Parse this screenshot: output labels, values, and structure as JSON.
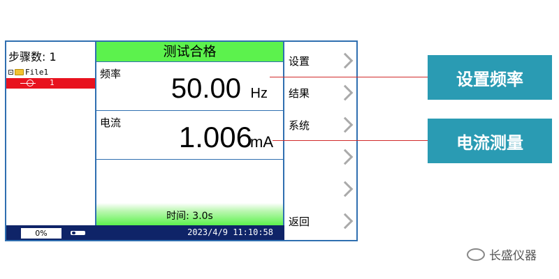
{
  "left": {
    "steps_label": "步骤数:",
    "steps_value": "1",
    "tree_file": "File1",
    "tree_item": "1"
  },
  "main": {
    "status": "测试合格",
    "freq_label": "频率",
    "freq_value": "50.00",
    "freq_unit": "Hz",
    "current_label": "电流",
    "current_value": "1.006",
    "current_unit": "mA",
    "time_text": "时间: 3.0s"
  },
  "menu": {
    "items": [
      {
        "label": "设置"
      },
      {
        "label": "结果"
      },
      {
        "label": "系统"
      },
      {
        "label": ""
      },
      {
        "label": ""
      },
      {
        "label": "返回"
      }
    ]
  },
  "bottom": {
    "percent": "0%",
    "datetime": "2023/4/9 11:10:58"
  },
  "callouts": {
    "c1": "设置频率",
    "c2": "电流测量"
  },
  "watermark": "长盛仪器",
  "colors": {
    "pass_green": "#5cf24d",
    "selection_red": "#e8121e",
    "status_bar": "#0f2468",
    "callout_teal": "#2a9bb3",
    "frame_blue": "#2f6fb0"
  }
}
